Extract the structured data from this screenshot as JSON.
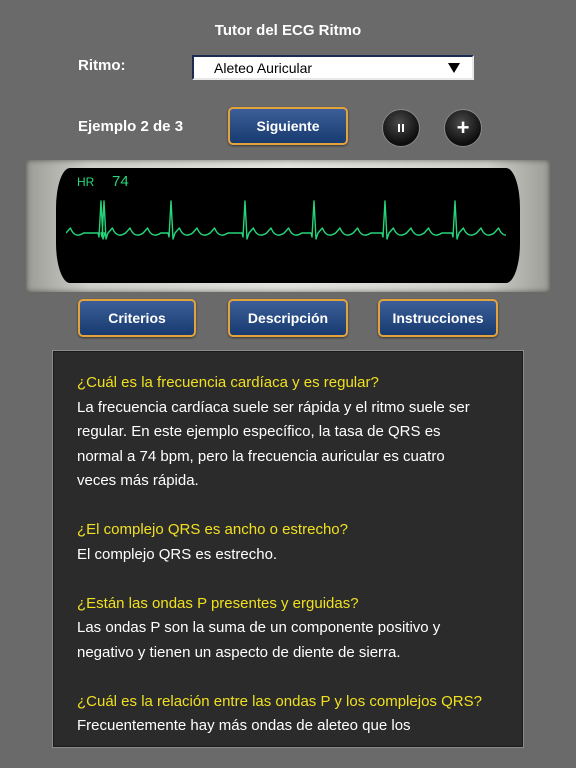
{
  "header": {
    "title": "Tutor del ECG Ritmo"
  },
  "rhythm": {
    "label": "Ritmo:",
    "selected": "Aleteo Auricular"
  },
  "example": {
    "counter": "Ejemplo 2 de 3",
    "next_label": "Siguiente"
  },
  "controls": {
    "pause_icon": "pause-icon",
    "plus_icon": "plus-icon"
  },
  "monitor": {
    "hr_label": "HR",
    "hr_value": "74",
    "trace_color": "#27d67a"
  },
  "tabs": {
    "criteria": "Criterios",
    "description": "Descripción",
    "instructions": "Instrucciones"
  },
  "colors": {
    "question": "#f0e020",
    "button_border": "#e3a33a",
    "button_fill": "#173a70"
  },
  "content": {
    "q1": "¿Cuál es la frecuencia cardíaca y es regular?",
    "a1": [
      "La frecuencia cardíaca suele ser rápida y el ritmo suele ser",
      "regular. En este ejemplo específico, la tasa de QRS es",
      "normal a 74 bpm, pero la frecuencia auricular es cuatro",
      "veces más rápida."
    ],
    "q2": "¿El complejo QRS es ancho o estrecho?",
    "a2": [
      "El complejo QRS es estrecho."
    ],
    "q3": "¿Están las ondas P presentes y erguidas?",
    "a3": [
      "Las ondas P son la suma de un componente positivo y",
      "negativo y tienen un aspecto de diente de sierra."
    ],
    "q4": "¿Cuál es la relación entre las ondas P y los complejos QRS?",
    "a4": [
      "Frecuentemente hay más ondas de aleteo que los"
    ]
  }
}
